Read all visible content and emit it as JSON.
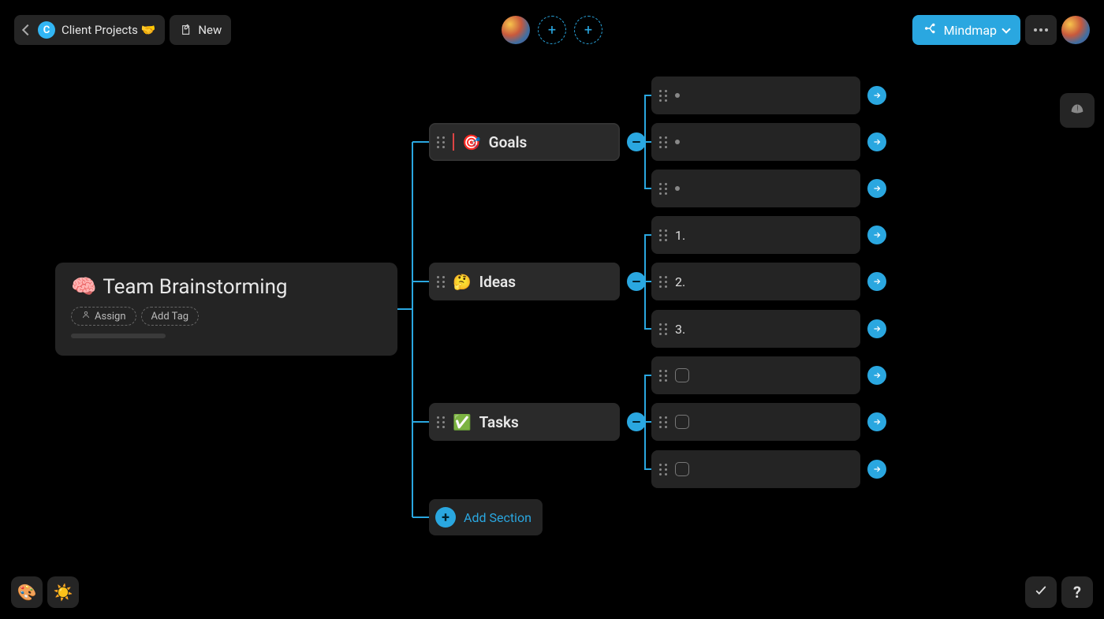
{
  "header": {
    "project_badge_letter": "C",
    "project_title": "Client Projects 🤝",
    "new_label": "New",
    "view_switch_label": "Mindmap"
  },
  "root": {
    "emoji": "🧠",
    "title": "Team Brainstorming",
    "assign_label": "Assign",
    "add_tag_label": "Add Tag"
  },
  "sections": [
    {
      "emoji": "🎯",
      "title": "Goals",
      "items": [
        {
          "kind": "bullet",
          "text": ""
        },
        {
          "kind": "bullet",
          "text": ""
        },
        {
          "kind": "bullet",
          "text": ""
        }
      ]
    },
    {
      "emoji": "🤔",
      "title": "Ideas",
      "items": [
        {
          "kind": "number",
          "label": "1.",
          "text": ""
        },
        {
          "kind": "number",
          "label": "2.",
          "text": ""
        },
        {
          "kind": "number",
          "label": "3.",
          "text": ""
        }
      ]
    },
    {
      "emoji": "✅",
      "title": "Tasks",
      "items": [
        {
          "kind": "check",
          "text": ""
        },
        {
          "kind": "check",
          "text": ""
        },
        {
          "kind": "check",
          "text": ""
        }
      ]
    }
  ],
  "add_section_label": "Add Section",
  "icons": {
    "palette": "🎨",
    "brightness": "☀️"
  }
}
